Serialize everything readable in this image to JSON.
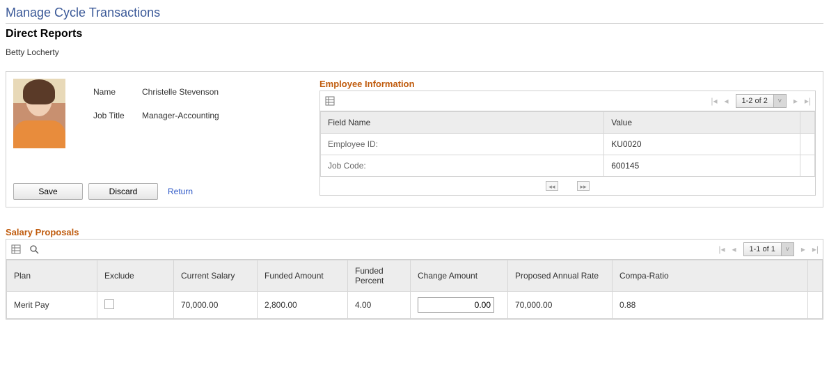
{
  "page": {
    "title": "Manage Cycle Transactions",
    "section": "Direct Reports",
    "user": "Betty Locherty"
  },
  "employee": {
    "name_label": "Name",
    "name_value": "Christelle Stevenson",
    "jobtitle_label": "Job Title",
    "jobtitle_value": "Manager-Accounting"
  },
  "actions": {
    "save": "Save",
    "discard": "Discard",
    "return": "Return"
  },
  "empinfo": {
    "title": "Employee Information",
    "pager_range": "1-2 of 2",
    "headers": {
      "field": "Field Name",
      "value": "Value"
    },
    "rows": [
      {
        "field": "Employee ID:",
        "value": "KU0020"
      },
      {
        "field": "Job Code:",
        "value": "600145"
      }
    ]
  },
  "salary": {
    "title": "Salary Proposals",
    "pager_range": "1-1 of 1",
    "headers": {
      "plan": "Plan",
      "exclude": "Exclude",
      "current": "Current Salary",
      "funded_amt": "Funded Amount",
      "funded_pct": "Funded Percent",
      "change": "Change Amount",
      "proposed": "Proposed Annual Rate",
      "compa": "Compa-Ratio"
    },
    "rows": [
      {
        "plan": "Merit Pay",
        "exclude": false,
        "current": "70,000.00",
        "funded_amt": "2,800.00",
        "funded_pct": "4.00",
        "change": "0.00",
        "proposed": "70,000.00",
        "compa": "0.88"
      }
    ]
  }
}
